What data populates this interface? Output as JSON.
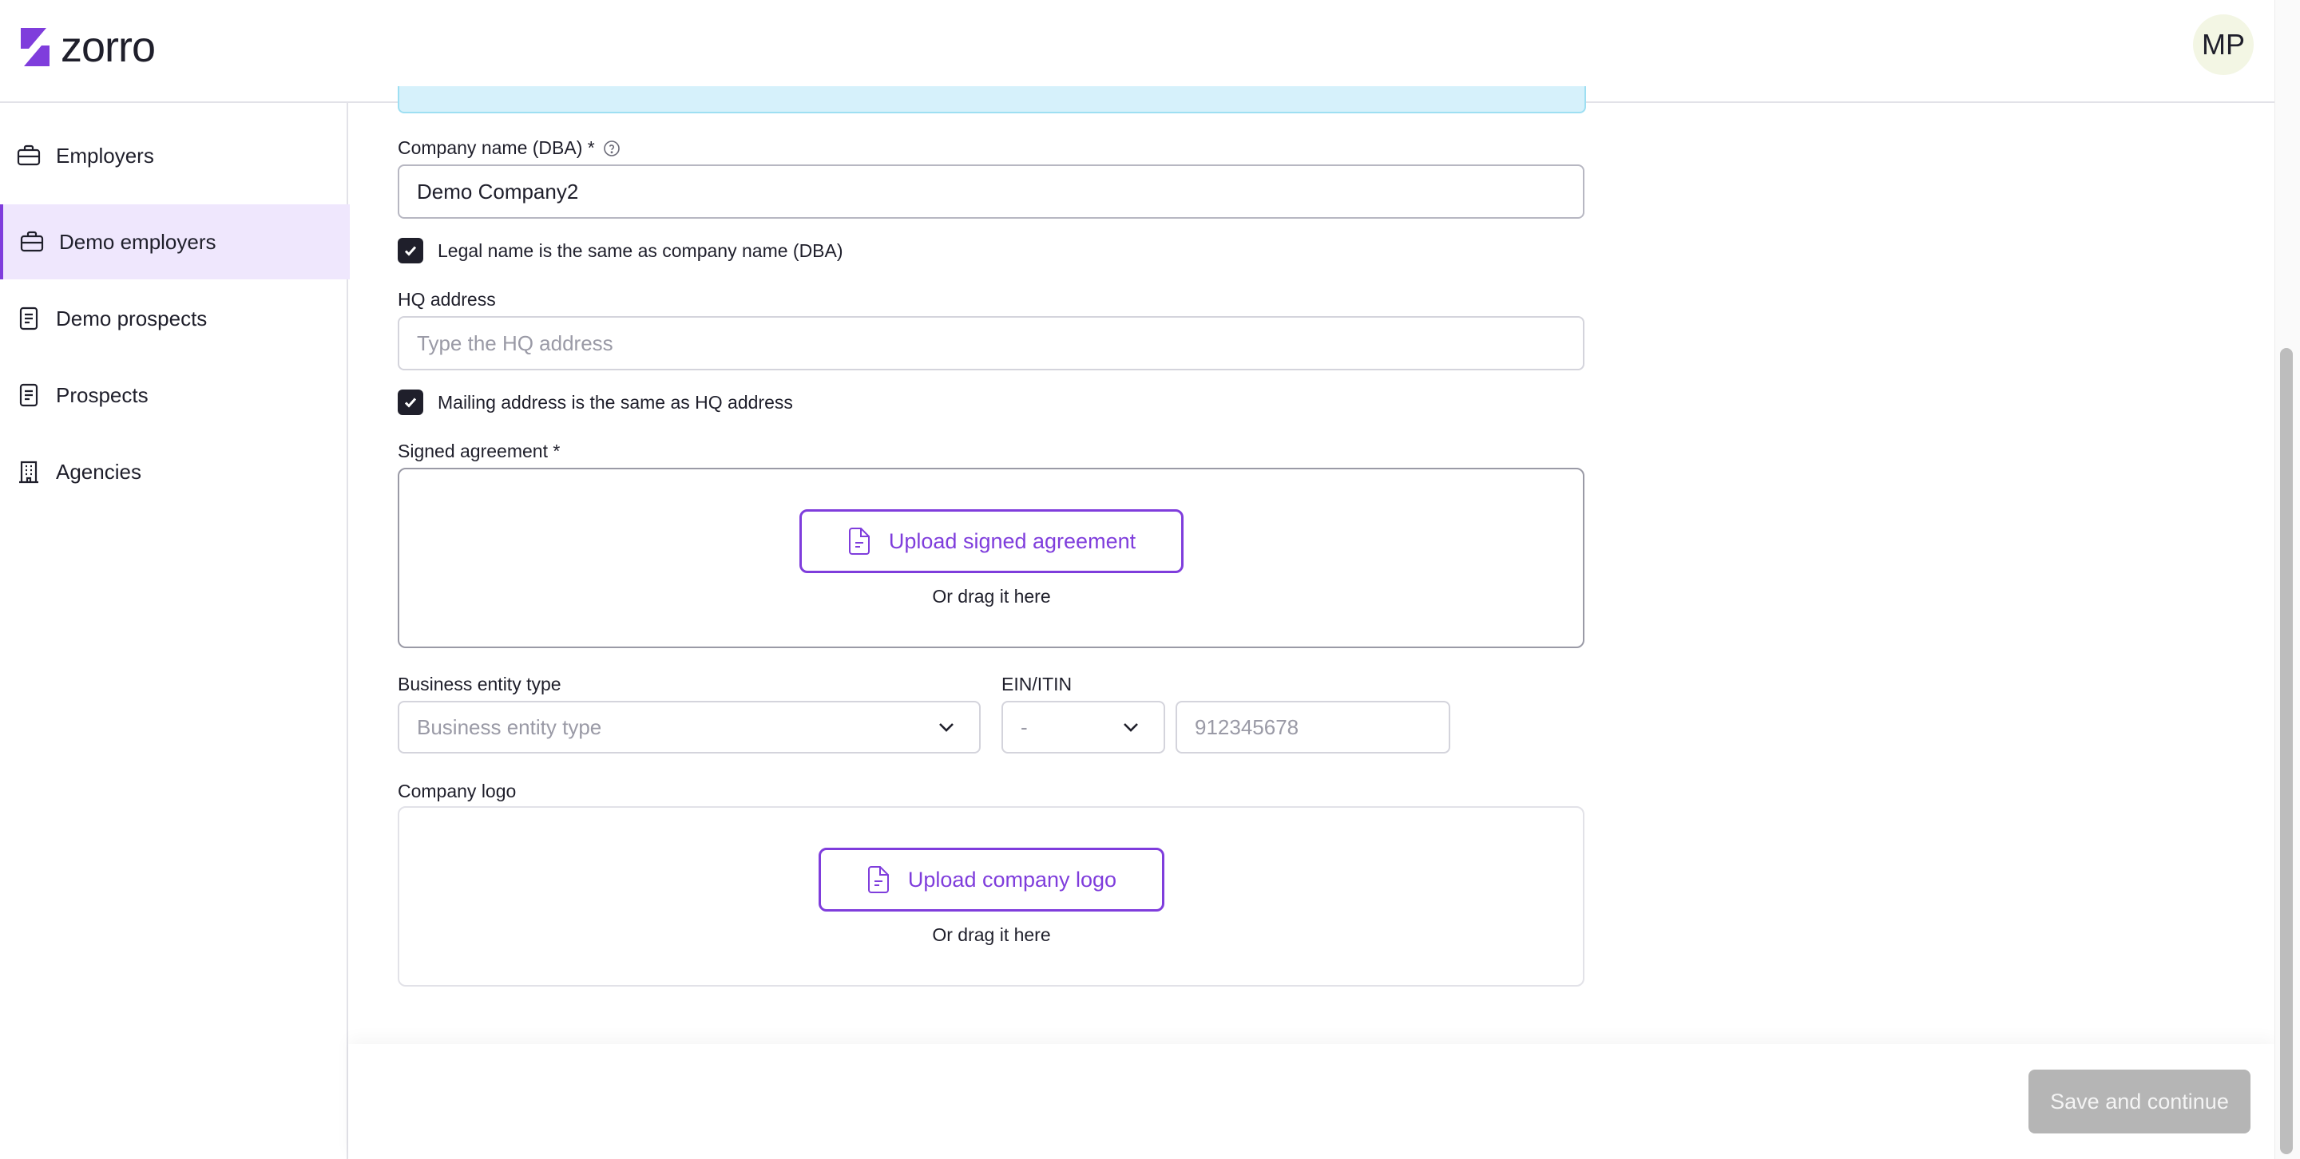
{
  "app": {
    "logo_text": "zorro"
  },
  "header": {
    "avatar_initials": "MP"
  },
  "sidebar": {
    "items": [
      {
        "label": "Employers",
        "icon": "briefcase-icon"
      },
      {
        "label": "Demo employers",
        "icon": "briefcase-icon",
        "active": true
      },
      {
        "label": "Demo prospects",
        "icon": "document-icon"
      },
      {
        "label": "Prospects",
        "icon": "document-icon"
      },
      {
        "label": "Agencies",
        "icon": "building-icon"
      }
    ]
  },
  "form": {
    "company_name": {
      "label": "Company name (DBA) *",
      "value": "Demo Company2",
      "help_icon": "question-circle-icon"
    },
    "legal_same": {
      "label": "Legal name is the same as company name (DBA)",
      "checked": true
    },
    "hq_address": {
      "label": "HQ address",
      "placeholder": "Type the HQ address",
      "value": ""
    },
    "mailing_same": {
      "label": "Mailing address is the same as HQ address",
      "checked": true
    },
    "signed_agreement": {
      "label": "Signed agreement *",
      "button": "Upload signed agreement",
      "drag_text": "Or drag it here"
    },
    "business_entity": {
      "label": "Business entity type",
      "placeholder": "Business entity type"
    },
    "ein": {
      "label": "EIN/ITIN",
      "type_placeholder": "-",
      "number_placeholder": "912345678"
    },
    "company_logo": {
      "label": "Company logo",
      "button": "Upload company logo",
      "drag_text": "Or drag it here"
    }
  },
  "footer": {
    "save_label": "Save and continue"
  },
  "colors": {
    "accent": "#7f3ddc",
    "active_bg": "#efe7fd",
    "info_bg": "#d6f1fb",
    "disabled_btn": "#b5b5b5"
  }
}
